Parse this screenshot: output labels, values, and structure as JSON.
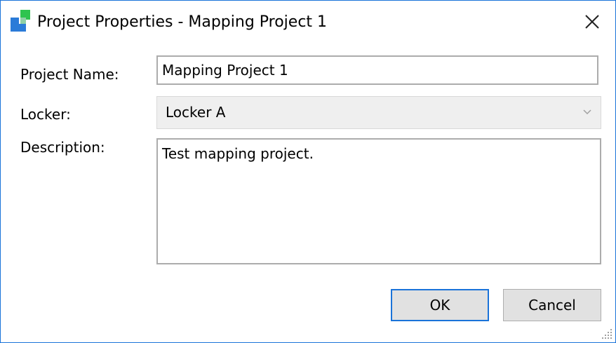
{
  "window": {
    "title": "Project Properties - Mapping Project 1",
    "accent_color": "#1a73d9",
    "app_icon": "app-logo-icon",
    "close_icon": "close-icon"
  },
  "form": {
    "project_name_label": "Project Name:",
    "project_name_value": "Mapping Project 1",
    "locker_label": "Locker:",
    "locker_value": "Locker A",
    "locker_arrow_icon": "chevron-down-icon",
    "description_label": "Description:",
    "description_value": "Test mapping project."
  },
  "buttons": {
    "ok_label": "OK",
    "cancel_label": "Cancel"
  }
}
